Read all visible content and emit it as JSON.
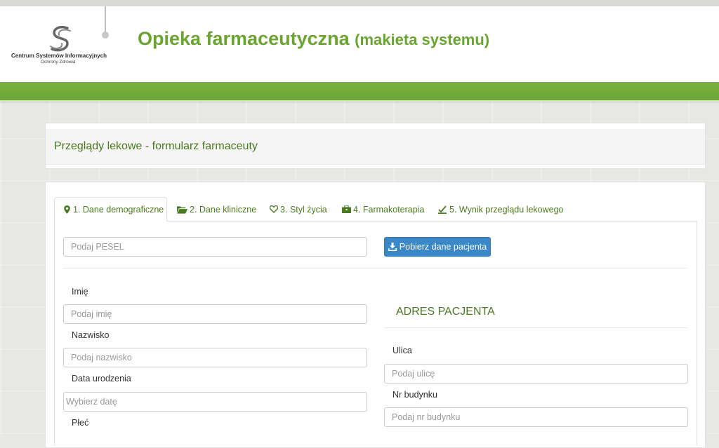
{
  "header": {
    "logo_name": "Centrum Systemów Informacyjnych",
    "logo_sub": "Ochrony Zdrowia",
    "title_main": "Opieka farmaceutyczna",
    "title_paren": "(makieta systemu)"
  },
  "page": {
    "title": "Przeglądy lekowe - formularz farmaceuty"
  },
  "tabs": [
    {
      "label": "1. Dane demograficzne",
      "icon": "map-marker-icon",
      "active": true
    },
    {
      "label": "2. Dane kliniczne",
      "icon": "folder-open-icon",
      "active": false
    },
    {
      "label": "3. Styl życia",
      "icon": "heart-icon",
      "active": false
    },
    {
      "label": "4. Farmakoterapia",
      "icon": "briefcase-icon",
      "active": false
    },
    {
      "label": "5. Wynik przeglądu lekowego",
      "icon": "check-edit-icon",
      "active": false
    }
  ],
  "pesel": {
    "placeholder": "Podaj PESEL",
    "button": "Pobierz dane pacjenta"
  },
  "form": {
    "first_name_label": "Imię",
    "first_name_placeholder": "Podaj imię",
    "last_name_label": "Nazwisko",
    "last_name_placeholder": "Podaj nazwisko",
    "dob_label": "Data urodzenia",
    "dob_placeholder": "Wybierz datę",
    "sex_label": "Płeć"
  },
  "address": {
    "heading": "ADRES PACJENTA",
    "street_label": "Ulica",
    "street_placeholder": "Podaj ulicę",
    "building_label": "Nr budynku",
    "building_placeholder": "Podaj nr budynku"
  },
  "colors": {
    "brand_green": "#6aa52f",
    "heading_green": "#4a7a1f",
    "primary_blue": "#3a88c8"
  }
}
